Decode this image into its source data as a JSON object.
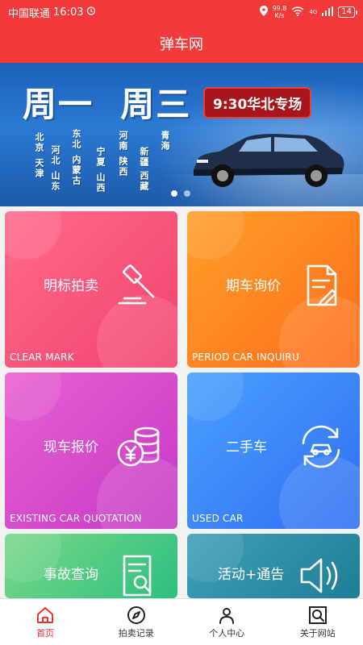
{
  "status_bar": {
    "carrier": "中国联通",
    "time": "16:03",
    "speed_value": "99.8",
    "speed_unit": "K/s",
    "network": "4G",
    "battery": "14"
  },
  "header": {
    "title": "弹车网"
  },
  "banner": {
    "headline": "周一  周三",
    "tag": "9:30华北专场",
    "cities": [
      "北京",
      "天津",
      "河北",
      "山东",
      "东北",
      "内蒙古",
      "宁夏",
      "山西",
      "河南",
      "陕西",
      "新疆",
      "西藏",
      "青海"
    ],
    "slide_count": 2,
    "active_slide": 0
  },
  "cards": [
    {
      "label": "明标拍卖",
      "sub": "CLEAR MARK",
      "icon": "gavel-icon"
    },
    {
      "label": "期车询价",
      "sub": "PERIOD CAR INQUIRU",
      "icon": "document-edit-icon"
    },
    {
      "label": "现车报价",
      "sub": "EXISTING CAR QUOTATION",
      "icon": "coins-yuan-icon"
    },
    {
      "label": "二手车",
      "sub": "USED CAR",
      "icon": "car-cycle-icon"
    },
    {
      "label": "事故查询",
      "sub": "",
      "icon": "document-search-icon"
    },
    {
      "label": "活动+通告",
      "sub": "",
      "icon": "speaker-icon"
    }
  ],
  "tabbar": {
    "items": [
      {
        "label": "首页",
        "icon": "home-icon"
      },
      {
        "label": "拍卖记录",
        "icon": "compass-icon"
      },
      {
        "label": "个人中心",
        "icon": "user-icon"
      },
      {
        "label": "关于网站",
        "icon": "search-frame-icon"
      }
    ],
    "active_index": 0
  },
  "colors": {
    "brand_red": "#f23a3a",
    "active_tab": "#e33333"
  }
}
